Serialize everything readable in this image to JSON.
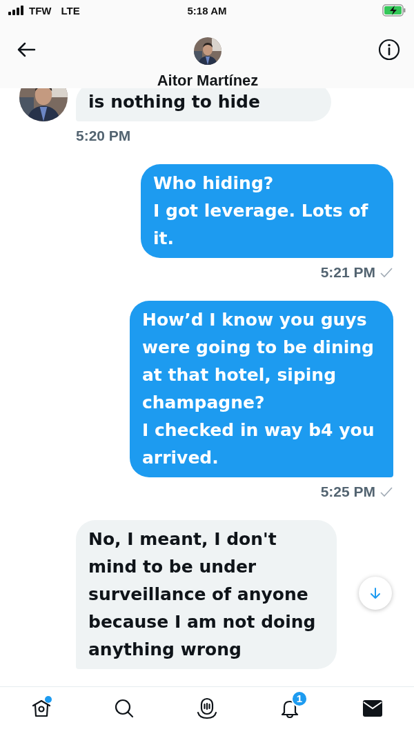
{
  "status_bar": {
    "carrier": "TFW",
    "network": "LTE",
    "time": "5:18 AM",
    "charging": true
  },
  "header": {
    "name": "Aitor Martínez"
  },
  "messages": [
    {
      "kind": "received",
      "text": "is nothing to hide",
      "time": "5:20 PM",
      "avatar": true
    },
    {
      "kind": "sent",
      "text": "Who hiding?\nI got leverage. Lots of it.",
      "time": "5:21 PM",
      "read": true
    },
    {
      "kind": "sent",
      "text": "How’d I know you guys were going to be dining at that hotel, siping champagne?\nI checked in way b4 you arrived.",
      "time": "5:25 PM",
      "read": true
    },
    {
      "kind": "received",
      "text": "No, I meant, I don't mind to be under surveillance of anyone because I am not doing anything wrong",
      "avatar": false
    }
  ],
  "nav": [
    {
      "kind": "home",
      "selected": false,
      "dot": true
    },
    {
      "kind": "search",
      "selected": false
    },
    {
      "kind": "spaces",
      "selected": false
    },
    {
      "kind": "notifications",
      "selected": false,
      "badge": "1"
    },
    {
      "kind": "messages",
      "selected": true
    }
  ]
}
